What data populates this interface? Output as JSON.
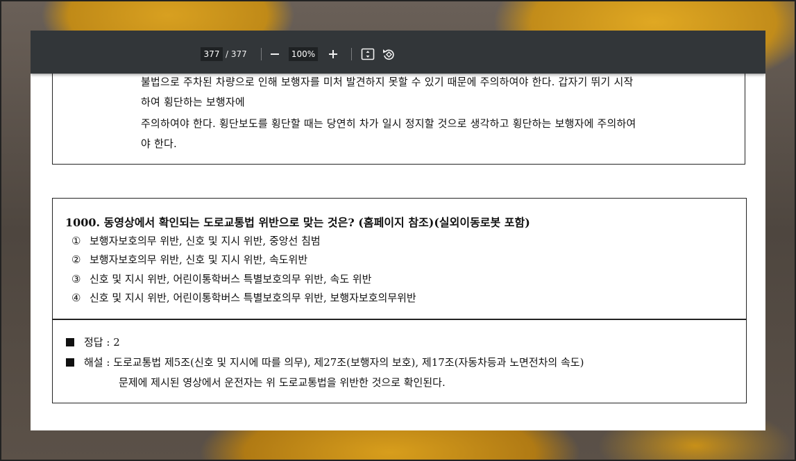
{
  "toolbar": {
    "current_page": "377",
    "total_pages": "/ 377",
    "zoom": "100%",
    "zoom_out_symbol": "−",
    "zoom_in_symbol": "+",
    "icons": [
      "fit-page-icon",
      "rotate-icon"
    ]
  },
  "prev_item": {
    "lines": [
      "불법으로 주차된 차량으로 인해 보행자를 미처 발견하지 못할 수 있기 때문에 주의하여야 한다. 갑자기 뛰기 시작",
      "하여 횡단하는 보행자에",
      "주의하여야 한다. 횡단보도를 횡단할 때는 당연히 차가 일시 정지할 것으로 생각하고 횡단하는 보행자에 주의하여",
      "야 한다."
    ]
  },
  "question": {
    "title": "1000. 동영상에서 확인되는 도로교통법 위반으로 맞는 것은? (홈페이지 참조)(실외이동로봇 포함)",
    "options": [
      {
        "num": "①",
        "text": "보행자보호의무 위반, 신호 및 지시 위반, 중앙선 침범"
      },
      {
        "num": "②",
        "text": "보행자보호의무 위반, 신호 및 지시 위반, 속도위반"
      },
      {
        "num": "③",
        "text": "신호 및 지시 위반, 어린이통학버스 특별보호의무 위반, 속도 위반"
      },
      {
        "num": "④",
        "text": "신호 및 지시 위반, 어린이통학버스 특별보호의무 위반, 보행자보호의무위반"
      }
    ],
    "answer_label": "정답 : 2",
    "explanation_label": "해설 : 도로교통법 제5조(신호 및 지시에 따를 의무), 제27조(보행자의 보호), 제17조(자동차등과 노면전차의 속도)",
    "explanation_cont": "문제에 제시된 영상에서 운전자는 위 도로교통법을 위반한 것으로 확인된다."
  }
}
